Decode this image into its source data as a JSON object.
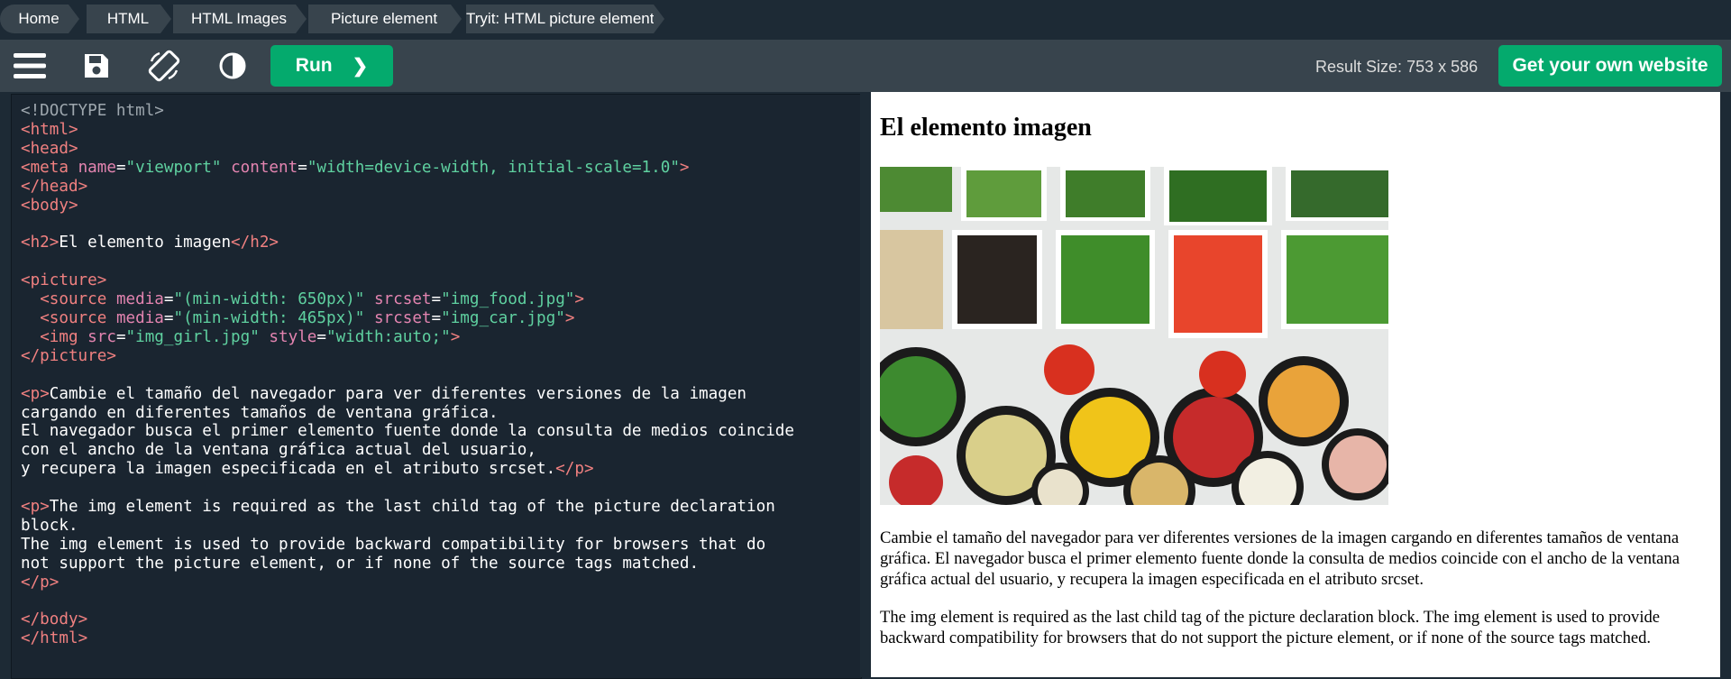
{
  "breadcrumb": {
    "items": [
      "Home",
      "HTML",
      "HTML Images",
      "Picture element"
    ],
    "current": "Tryit: HTML picture element"
  },
  "toolbar": {
    "menu_icon": "hamburger-menu-icon",
    "save_icon": "save-floppy-icon",
    "rotate_icon": "rotate-orientation-icon",
    "theme_icon": "contrast-theme-icon",
    "run_label": "Run",
    "run_arrow": "❯",
    "result_size_label": "Result Size:",
    "result_size_value": "753 x 586",
    "own_website_label": "Get your own website"
  },
  "editor": {
    "lines": [
      "<!DOCTYPE html>",
      "<html>",
      "<head>",
      "<meta name=\"viewport\" content=\"width=device-width, initial-scale=1.0\">",
      "</head>",
      "<body>",
      "",
      "<h2>El elemento imagen</h2>",
      "",
      "<picture>",
      "  <source media=\"(min-width: 650px)\" srcset=\"img_food.jpg\">",
      "  <source media=\"(min-width: 465px)\" srcset=\"img_car.jpg\">",
      "  <img src=\"img_girl.jpg\" style=\"width:auto;\">",
      "</picture>",
      "",
      "<p>Cambie el tamaño del navegador para ver diferentes versiones de la imagen",
      "cargando en diferentes tamaños de ventana gráfica.",
      "El navegador busca el primer elemento fuente donde la consulta de medios coincide",
      "con el ancho de la ventana gráfica actual del usuario,",
      "y recupera la imagen especificada en el atributo srcset.</p>",
      "",
      "<p>The img element is required as the last child tag of the picture declaration",
      "block.",
      "The img element is used to provide backward compatibility for browsers that do",
      "not support the picture element, or if none of the source tags matched.",
      "</p>",
      "",
      "</body>",
      "</html>"
    ]
  },
  "result": {
    "heading": "El elemento imagen",
    "image_name": "food-bowls-photo",
    "paragraph1": "Cambie el tamaño del navegador para ver diferentes versiones de la imagen cargando en diferentes tamaños de ventana gráfica. El navegador busca el primer elemento fuente donde la consulta de medios coincide con el ancho de la ventana gráfica actual del usuario, y recupera la imagen especificada en el atributo srcset.",
    "paragraph2": "The img element is required as the last child tag of the picture declaration block. The img element is used to provide backward compatibility for browsers that do not support the picture element, or if none of the source tags matched."
  },
  "colors": {
    "accent_green": "#04aa6d",
    "toolbar_bg": "#38444d",
    "page_bg": "#1d2a35",
    "editor_bg": "#1a2530"
  }
}
